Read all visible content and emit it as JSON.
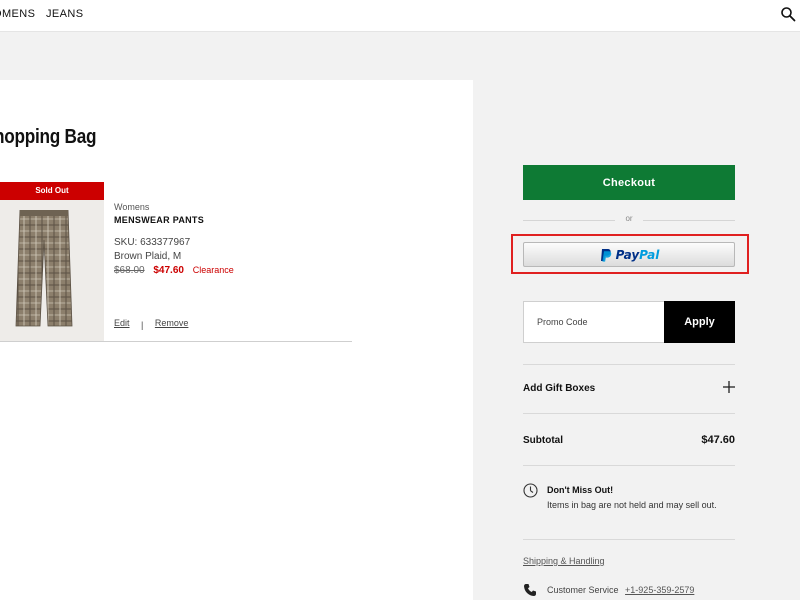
{
  "nav": {
    "womens": "OMENS",
    "jeans": "JEANS",
    "search_icon": "search-icon"
  },
  "bag": {
    "title": "hopping Bag",
    "item": {
      "badge": "Sold Out",
      "category": "Womens",
      "name": "MENSWEAR PANTS",
      "sku": "SKU: 633377967",
      "variant": "Brown Plaid, M",
      "original_price": "$68.00",
      "sale_price": "$47.60",
      "tag": "Clearance",
      "edit_label": "Edit",
      "separator": "|",
      "remove_label": "Remove"
    }
  },
  "summary": {
    "checkout_label": "Checkout",
    "or_label": "or",
    "paypal": {
      "pay": "Pay",
      "pal": "Pal"
    },
    "promo_placeholder": "Promo Code",
    "apply_label": "Apply",
    "gift_boxes_label": "Add Gift Boxes",
    "subtotal_label": "Subtotal",
    "subtotal_value": "$47.60",
    "dont_miss_title": "Don't Miss Out!",
    "dont_miss_text": "Items in bag are not held and may sell out.",
    "shipping_link": "Shipping & Handling",
    "customer_service_label": "Customer Service",
    "customer_service_phone": "+1-925-359-2579"
  },
  "colors": {
    "checkout_green": "#0e7a34",
    "sale_red": "#cc0000",
    "highlight_red": "#e02020",
    "paypal_dark": "#003087",
    "paypal_light": "#009cde"
  }
}
